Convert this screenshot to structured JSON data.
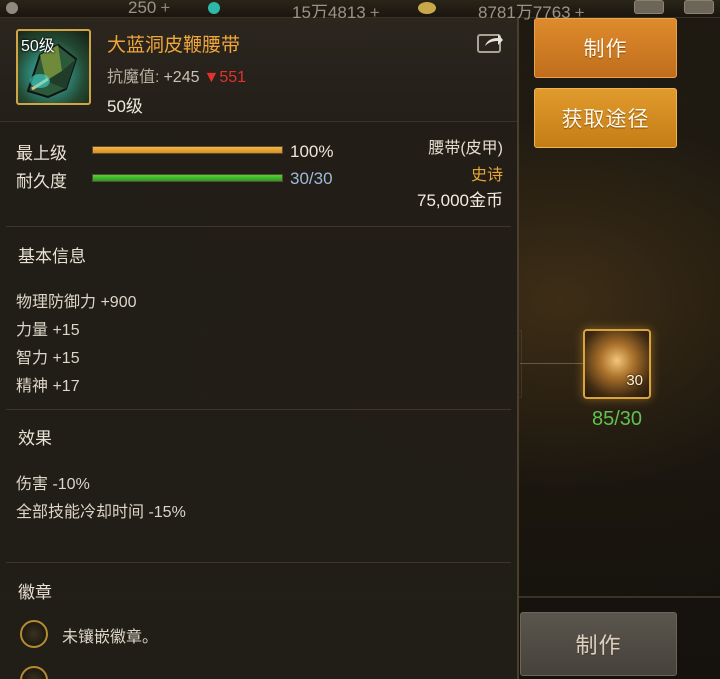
{
  "topbar": {
    "res1": "250",
    "res2": "15万4813",
    "res3": "8781万7763",
    "plus": "+"
  },
  "item": {
    "level_badge": "50级",
    "name": "大蓝洞皮鞭腰带",
    "stat_label": "抗魔值:",
    "stat_value": "+245",
    "stat_diff": "▼551",
    "level_text": "50级",
    "type": "腰带(皮甲)",
    "rarity": "史诗",
    "price": "75,000金币"
  },
  "bars": {
    "upgrade_label": "最上级",
    "upgrade_value": "100%",
    "upgrade_fraction": 1.0,
    "durability_label": "耐久度",
    "durability_value": "30/30",
    "durability_fraction": 1.0
  },
  "basic_info": {
    "title": "基本信息",
    "lines": [
      "物理防御力 +900",
      "力量 +15",
      "智力 +15",
      "精神 +17"
    ]
  },
  "effects": {
    "title": "效果",
    "lines": [
      "伤害 -10%",
      "全部技能冷却时间 -15%"
    ]
  },
  "emblem": {
    "title": "徽章",
    "slot_text": "未镶嵌徽章。"
  },
  "buttons": {
    "make": "制作",
    "source": "获取途径",
    "make_bottom": "制作"
  },
  "material": {
    "slot_qty": "30",
    "count": "85/30"
  },
  "colors": {
    "accent_orange": "#de8a2d",
    "item_name": "#f0a63a",
    "rarity": "#e6a636",
    "stat_down": "#e2322b",
    "durability_bar": "#52d436",
    "material_count": "#5fc24f"
  },
  "icons": [
    "coin-icon",
    "gem-icon",
    "gold-icon",
    "mail-icon",
    "share-icon",
    "belt-icon",
    "emblem-slot-icon"
  ]
}
